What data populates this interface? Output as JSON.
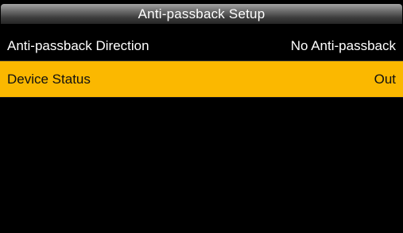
{
  "header": {
    "title": "Anti-passback Setup"
  },
  "menu": {
    "items": [
      {
        "label": "Anti-passback Direction",
        "value": "No Anti-passback"
      },
      {
        "label": "Device Status",
        "value": "Out"
      }
    ]
  },
  "colors": {
    "selected_row": "#fbb800",
    "background": "#000000",
    "text": "#ffffff"
  }
}
